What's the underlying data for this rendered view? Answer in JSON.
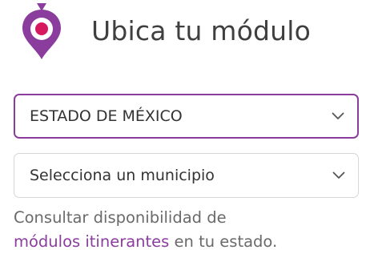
{
  "header": {
    "title": "Ubica tu módulo",
    "icon": "map-pin-icon"
  },
  "state_select": {
    "selected": "ESTADO DE MÉXICO",
    "icon": "chevron-down-icon",
    "active": true
  },
  "municipio_select": {
    "selected": "Selecciona un municipio",
    "icon": "chevron-down-icon"
  },
  "info": {
    "line1": "Consultar disponibilidad de",
    "link": "módulos itinerantes",
    "line2_rest": " en tu estado."
  },
  "colors": {
    "accent": "#8b3d9e",
    "pin_center": "#d6185e",
    "title_text": "#3f3f3f",
    "body_text": "#6a6a6a",
    "border": "#d6d6d6"
  }
}
